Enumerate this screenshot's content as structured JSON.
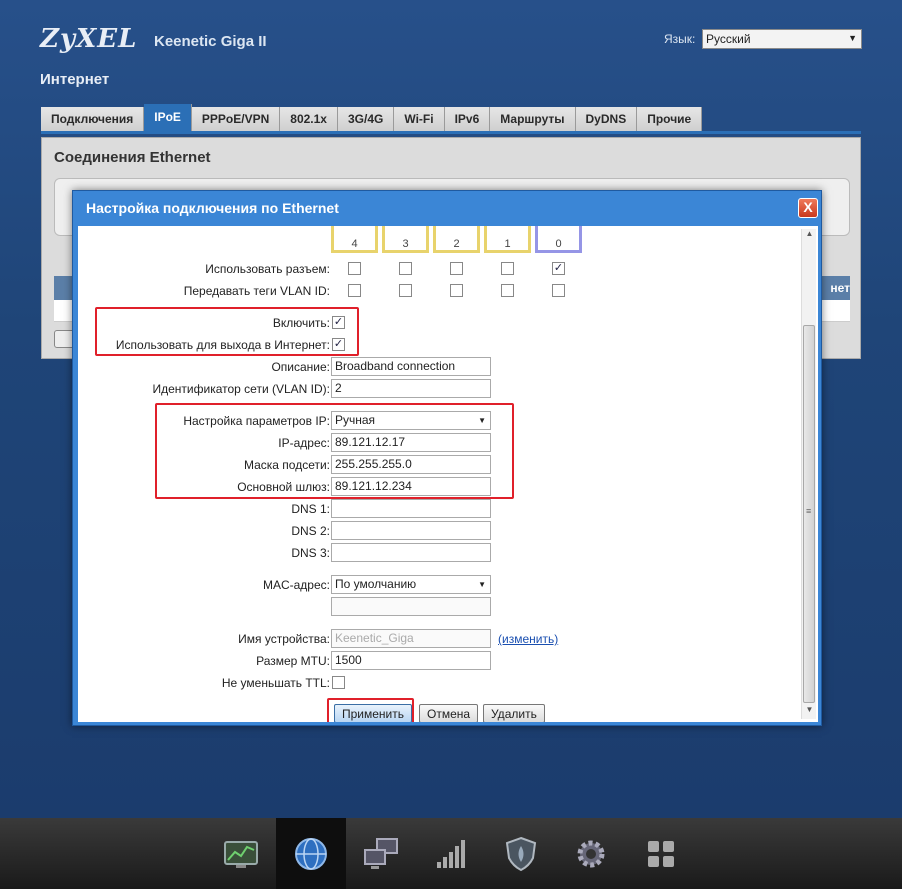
{
  "header": {
    "brand": "ZyXEL",
    "model": "Keenetic Giga II",
    "lang_label": "Язык:",
    "lang_value": "Русский",
    "section_title": "Интернет"
  },
  "tabs": [
    {
      "label": "Подключения"
    },
    {
      "label": "IPoE"
    },
    {
      "label": "PPPoE/VPN"
    },
    {
      "label": "802.1x"
    },
    {
      "label": "3G/4G"
    },
    {
      "label": "Wi-Fi"
    },
    {
      "label": "IPv6"
    },
    {
      "label": "Маршруты"
    },
    {
      "label": "DyDNS"
    },
    {
      "label": "Прочие"
    }
  ],
  "panel": {
    "title": "Соединения Ethernet",
    "grid_right": "нет"
  },
  "dialog": {
    "title": "Настройка подключения по Ethernet",
    "close": "X",
    "ports": [
      "4",
      "3",
      "2",
      "1",
      "0"
    ],
    "use_port_label": "Использовать разъем:",
    "use_port_checked": [
      false,
      false,
      false,
      false,
      true
    ],
    "vlan_tags_label": "Передавать теги VLAN ID:",
    "vlan_tags_checked": [
      false,
      false,
      false,
      false,
      false
    ],
    "enable_label": "Включить:",
    "enable_checked": true,
    "internet_label": "Использовать для выхода в Интернет:",
    "internet_checked": true,
    "description_label": "Описание:",
    "description_value": "Broadband connection",
    "vlan_id_label": "Идентификатор сети (VLAN ID):",
    "vlan_id_value": "2",
    "ip_mode_label": "Настройка параметров IP:",
    "ip_mode_value": "Ручная",
    "ip_label": "IP-адрес:",
    "ip_value": "89.121.12.17",
    "mask_label": "Маска подсети:",
    "mask_value": "255.255.255.0",
    "gateway_label": "Основной шлюз:",
    "gateway_value": "89.121.12.234",
    "dns1_label": "DNS 1:",
    "dns1_value": "",
    "dns2_label": "DNS 2:",
    "dns2_value": "",
    "dns3_label": "DNS 3:",
    "dns3_value": "",
    "mac_label": "MAC-адрес:",
    "mac_value": "По умолчанию",
    "mac_extra_value": "",
    "device_name_label": "Имя устройства:",
    "device_name_placeholder": "Keenetic_Giga",
    "device_name_link": "(изменить)",
    "mtu_label": "Размер MTU:",
    "mtu_value": "1500",
    "ttl_label": "Не уменьшать TTL:",
    "ttl_checked": false,
    "apply_label": "Применить",
    "cancel_label": "Отмена",
    "delete_label": "Удалить"
  },
  "bottom_nav": [
    {
      "icon": "monitor-chart-icon"
    },
    {
      "icon": "globe-icon",
      "active": true
    },
    {
      "icon": "network-computers-icon"
    },
    {
      "icon": "signal-bars-icon"
    },
    {
      "icon": "shield-icon"
    },
    {
      "icon": "gear-icon"
    },
    {
      "icon": "apps-grid-icon"
    }
  ]
}
